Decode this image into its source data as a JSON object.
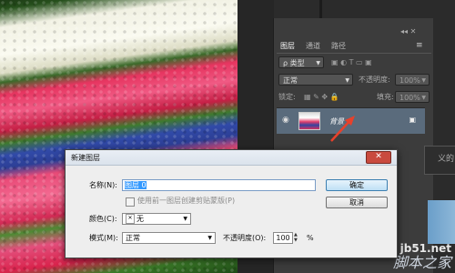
{
  "colors": {
    "selection": "#3399ff",
    "layer_row": "#5a6b7c",
    "arrow": "#e8412b",
    "close": "#c94a3e"
  },
  "layers_panel": {
    "tabs": [
      {
        "label": "图层"
      },
      {
        "label": "通道"
      },
      {
        "label": "路径"
      }
    ],
    "panel_icons": "◂◂ ✕",
    "menu_icon": "≡",
    "filter": {
      "label": "ρ 类型",
      "icons": "▣ ◐ T ▭ ▣"
    },
    "blend": {
      "value": "正常",
      "opacity_label": "不透明度:",
      "opacity_value": "100%"
    },
    "lock": {
      "label": "锁定:",
      "icons": "▦ ✎ ✥ 🔒",
      "fill_label": "填充:",
      "fill_value": "100%"
    },
    "layer": {
      "name": "背景",
      "eye_icon": "eye-icon",
      "lock_icon": "lock-icon"
    }
  },
  "dialog": {
    "title": "新建图层",
    "close_label": "✕",
    "name_label": "名称(N):",
    "name_value": "图层 0",
    "ok_label": "确定",
    "cancel_label": "取消",
    "clip_label": "使用前一图层创建剪贴蒙版(P)",
    "color_label": "颜色(C):",
    "color_value": "无",
    "color_swatch": "✕",
    "mode_label": "模式(M):",
    "mode_value": "正常",
    "opacity_label": "不透明度(O):",
    "opacity_value": "100",
    "percent": "%"
  },
  "partial_doc_text": "义的",
  "watermark": {
    "url": "jb51.net",
    "cn": "脚本之家"
  }
}
